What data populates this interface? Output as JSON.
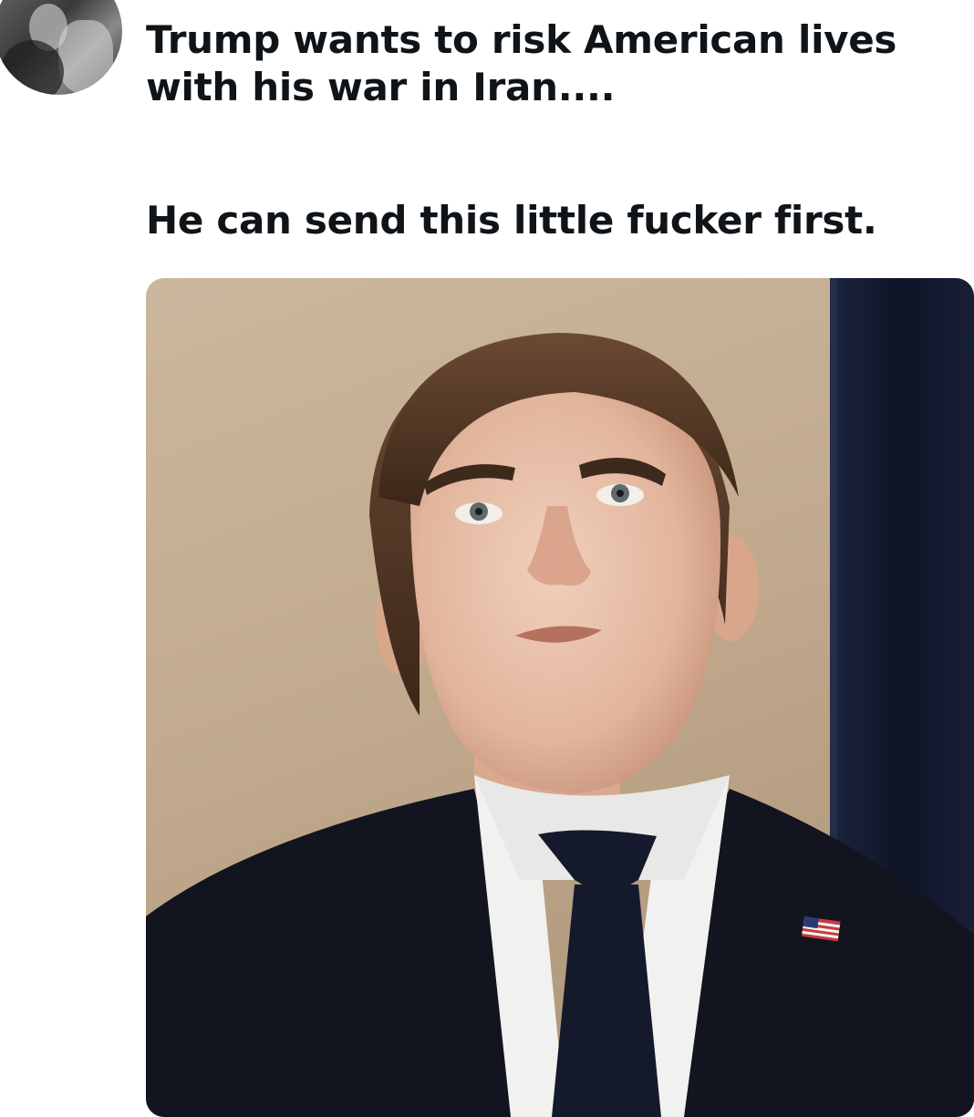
{
  "tweet": {
    "text_line1": "Trump wants to risk American lives with his war in Iran....",
    "text_line2": "He can send this little fucker first."
  },
  "avatar": {
    "icon": "profile-avatar"
  },
  "media": {
    "icon": "photo-young-man-suit-flag-pin"
  },
  "colors": {
    "text": "#0f1419",
    "background": "#ffffff",
    "curtain": "#121a2e",
    "suit": "#121522",
    "wall": "#c5af93"
  }
}
